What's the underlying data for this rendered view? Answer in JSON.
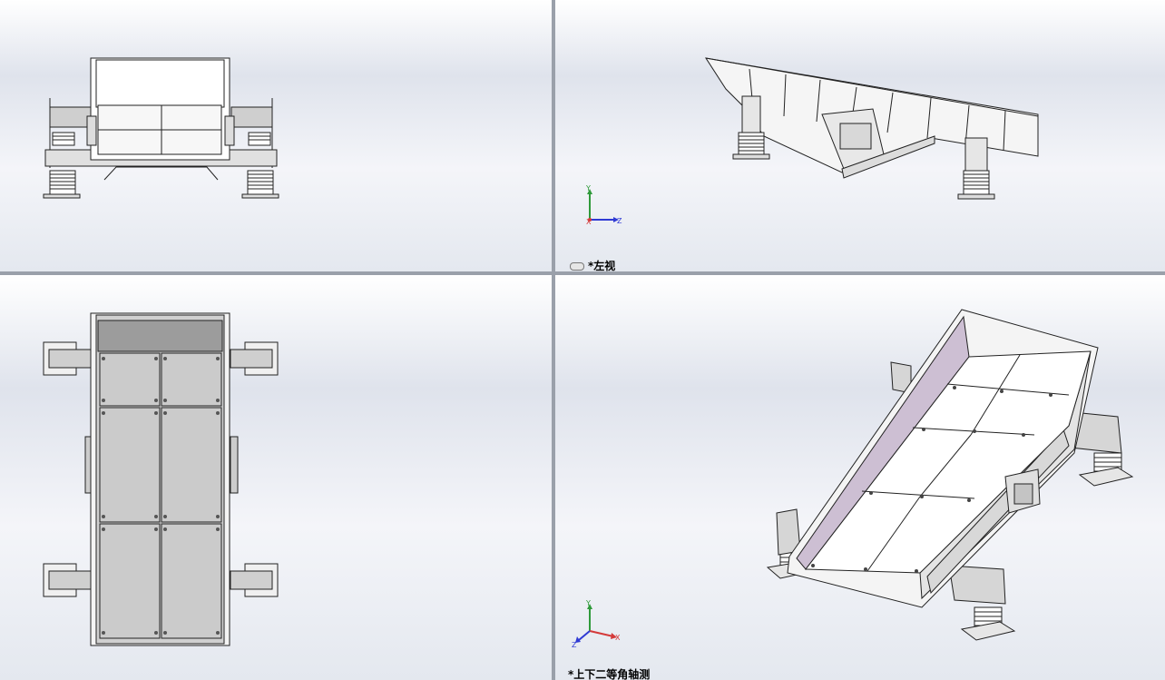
{
  "viewports": {
    "top_left": {
      "name": "front-view"
    },
    "top_right": {
      "name": "left-view",
      "label": "*左视"
    },
    "bottom_left": {
      "name": "top-view"
    },
    "bottom_right": {
      "name": "isometric-view",
      "label": "*上下二等角轴测"
    }
  },
  "triad": {
    "x": "X",
    "y": "Y",
    "z": "Z"
  },
  "colors": {
    "background_top": "#ffffff",
    "background_bottom": "#e2e6ee",
    "separator": "#9aa0aa",
    "part_fill": "#f2f2f2",
    "plate_gray": "#c8c8c8",
    "liner_purple": "#cdbfd3",
    "axis_x": "#d43a3a",
    "axis_y": "#2f9a3a",
    "axis_z": "#2f3ad4"
  }
}
